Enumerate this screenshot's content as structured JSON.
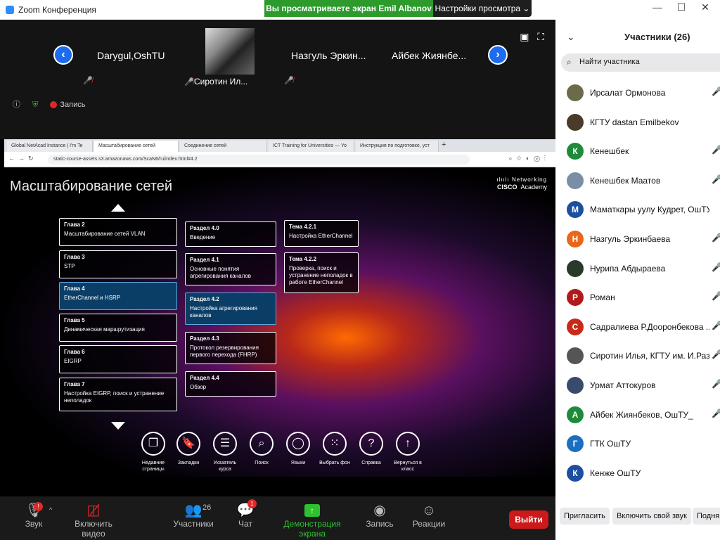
{
  "app": {
    "title": "Zoom Конференция"
  },
  "share_banner": "Вы просматриваете экран Emil Albanov",
  "view_settings": "Настройки просмотра ⌄",
  "gallery": {
    "tiles": [
      {
        "name": "Darygul,OshTU"
      },
      {
        "name": "Сиротин Ил..."
      },
      {
        "name": "Назгуль  Эркин..."
      },
      {
        "name": "Айбек  Жиянбе..."
      }
    ],
    "status": {
      "record_label": "Запись"
    }
  },
  "browser": {
    "tabs": [
      {
        "label": "Global NetAcad Instance | I'm Te"
      },
      {
        "label": "Масштабирование сетей"
      },
      {
        "label": "Соединение сетей"
      },
      {
        "label": "ICT Training for Universities — Yo"
      },
      {
        "label": "Инструкция по подготовке, уст"
      }
    ],
    "url": "static-course-assets.s3.amazonaws.com/ScaN6/ru/index.html#4.2"
  },
  "course": {
    "title": "Масштабирование сетей",
    "brand_top": "Networking",
    "brand_cisco": "CISCO",
    "brand_bottom": "Academy",
    "chapters": [
      {
        "h": "Глава 2",
        "t": "Масштабирование сетей VLAN"
      },
      {
        "h": "Глава 3",
        "t": "STP"
      },
      {
        "h": "Глава 4",
        "t": "EtherChannel и HSRP"
      },
      {
        "h": "Глава 5",
        "t": "Динамическая маршрутизация"
      },
      {
        "h": "Глава 6",
        "t": "EIGRP"
      },
      {
        "h": "Глава 7",
        "t": "Настройка EIGRP, поиск и устранение неполадок"
      }
    ],
    "sections": [
      {
        "h": "Раздел 4.0",
        "t": "Введение"
      },
      {
        "h": "Раздел 4.1",
        "t": "Основные понятия агрегирования каналов"
      },
      {
        "h": "Раздел 4.2",
        "t": "Настройка агрегирования каналов"
      },
      {
        "h": "Раздел 4.3",
        "t": "Протокол резервирования первого перехода (FHRP)"
      },
      {
        "h": "Раздел 4.4",
        "t": "Обзор"
      }
    ],
    "topics": [
      {
        "h": "Тема 4.2.1",
        "t": "Настройка EtherChannel"
      },
      {
        "h": "Тема 4.2.2",
        "t": "Проверка, поиск и устранение неполадок в работе EtherChannel"
      }
    ],
    "tools": [
      {
        "icon": "recent-pages-icon",
        "glyph": "❐",
        "label": "Недавние страницы"
      },
      {
        "icon": "bookmark-icon",
        "glyph": "🔖",
        "label": "Закладки"
      },
      {
        "icon": "index-icon",
        "glyph": "☰",
        "label": "Указатель курса"
      },
      {
        "icon": "search-icon",
        "glyph": "⌕",
        "label": "Поиск"
      },
      {
        "icon": "language-icon",
        "glyph": "◯",
        "label": "Языки"
      },
      {
        "icon": "background-icon",
        "glyph": "⁙",
        "label": "Выбрать фон"
      },
      {
        "icon": "help-icon",
        "glyph": "?",
        "label": "Справка"
      },
      {
        "icon": "home-icon",
        "glyph": "↑",
        "label": "Вернуться в класс"
      }
    ]
  },
  "toolbar": {
    "audio": "Звук",
    "audio_badge": "!",
    "video": "Включить видео",
    "participants": "Участники",
    "participants_count": "26",
    "chat": "Чат",
    "chat_badge": "1",
    "share": "Демонстрация экрана",
    "record": "Запись",
    "reactions": "Реакции",
    "leave": "Выйти"
  },
  "participants_panel": {
    "title": "Участники (26)",
    "search_placeholder": "Найти участника",
    "people": [
      {
        "name": "Ирсалат Ормонова",
        "initial": "",
        "color": "#6b6b4a",
        "muted": true
      },
      {
        "name": "КГТУ dastan Emilbekov",
        "initial": "",
        "color": "#4a3a2a",
        "muted": false
      },
      {
        "name": "Кенешбек",
        "initial": "К",
        "color": "#1e8a3a",
        "muted": true
      },
      {
        "name": "Кенешбек Маатов",
        "initial": "",
        "color": "#7a8fa6",
        "muted": true
      },
      {
        "name": "Маматкары уулу Кудрет, ОшТУ",
        "initial": "М",
        "color": "#1c4fa0",
        "muted": false
      },
      {
        "name": "Назгуль Эркинбаева",
        "initial": "Н",
        "color": "#e8671a",
        "muted": true
      },
      {
        "name": "Нурипа Абдыраева",
        "initial": "",
        "color": "#2a3a2a",
        "muted": true
      },
      {
        "name": "Роман",
        "initial": "Р",
        "color": "#b01a1a",
        "muted": true
      },
      {
        "name": "Садралиева Р.Дооронбекова ...",
        "initial": "С",
        "color": "#c82a1a",
        "muted": true
      },
      {
        "name": "Сиротин Илья, КГТУ им. И.Разз...",
        "initial": "",
        "color": "#555555",
        "muted": true
      },
      {
        "name": "Урмат Аттокуров",
        "initial": "",
        "color": "#3a4a6a",
        "muted": true
      },
      {
        "name": "Айбек Жиянбеков, ОшТУ_",
        "initial": "А",
        "color": "#1e8a3a",
        "muted": true
      },
      {
        "name": "ГТК ОшТУ",
        "initial": "Г",
        "color": "#1c6fc0",
        "muted": false
      },
      {
        "name": "Кенже ОшТУ",
        "initial": "К",
        "color": "#1c4fa0",
        "muted": false
      }
    ],
    "invite": "Пригласить",
    "unmute_self": "Включить свой звук",
    "more": "Подня"
  }
}
